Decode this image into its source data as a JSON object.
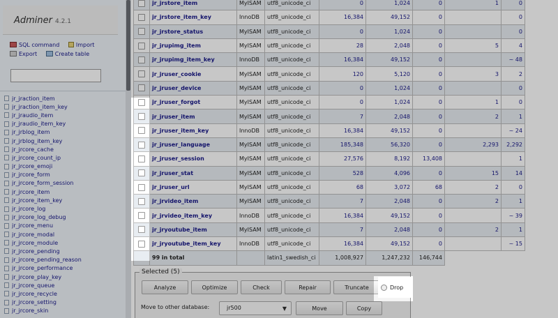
{
  "app": {
    "name": "Adminer",
    "version": "4.2.1"
  },
  "sidebar": {
    "links": [
      {
        "label": "SQL command",
        "icon": "sql-icon"
      },
      {
        "label": "Import",
        "icon": "import-icon"
      },
      {
        "label": "Export",
        "icon": "export-icon"
      },
      {
        "label": "Create table",
        "icon": "create-table-icon"
      }
    ],
    "search_value": "",
    "tables": [
      "jr_jraction_item",
      "jr_jraction_item_key",
      "jr_jraudio_item",
      "jr_jraudio_item_key",
      "jr_jrblog_item",
      "jr_jrblog_item_key",
      "jr_jrcore_cache",
      "jr_jrcore_count_ip",
      "jr_jrcore_emoji",
      "jr_jrcore_form",
      "jr_jrcore_form_session",
      "jr_jrcore_item",
      "jr_jrcore_item_key",
      "jr_jrcore_log",
      "jr_jrcore_log_debug",
      "jr_jrcore_menu",
      "jr_jrcore_modal",
      "jr_jrcore_module",
      "jr_jrcore_pending",
      "jr_jrcore_pending_reason",
      "jr_jrcore_performance",
      "jr_jrcore_play_key",
      "jr_jrcore_queue",
      "jr_jrcore_recycle",
      "jr_jrcore_setting",
      "jr_jrcore_skin"
    ]
  },
  "table": {
    "rows": [
      {
        "name": "jr_jrstore_item",
        "engine": "MyISAM",
        "collation": "utf8_unicode_ci",
        "data": "0",
        "index": "1,024",
        "free": "0",
        "auto": "1",
        "rows": "0"
      },
      {
        "name": "jr_jrstore_item_key",
        "engine": "InnoDB",
        "collation": "utf8_unicode_ci",
        "data": "16,384",
        "index": "49,152",
        "free": "0",
        "auto": "",
        "rows": "0"
      },
      {
        "name": "jr_jrstore_status",
        "engine": "MyISAM",
        "collation": "utf8_unicode_ci",
        "data": "0",
        "index": "1,024",
        "free": "0",
        "auto": "",
        "rows": "0"
      },
      {
        "name": "jr_jrupimg_item",
        "engine": "MyISAM",
        "collation": "utf8_unicode_ci",
        "data": "28",
        "index": "2,048",
        "free": "0",
        "auto": "5",
        "rows": "4"
      },
      {
        "name": "jr_jrupimg_item_key",
        "engine": "InnoDB",
        "collation": "utf8_unicode_ci",
        "data": "16,384",
        "index": "49,152",
        "free": "0",
        "auto": "",
        "rows": "~ 48"
      },
      {
        "name": "jr_jruser_cookie",
        "engine": "MyISAM",
        "collation": "utf8_unicode_ci",
        "data": "120",
        "index": "5,120",
        "free": "0",
        "auto": "3",
        "rows": "2"
      },
      {
        "name": "jr_jruser_device",
        "engine": "MyISAM",
        "collation": "utf8_unicode_ci",
        "data": "0",
        "index": "1,024",
        "free": "0",
        "auto": "",
        "rows": "0"
      },
      {
        "name": "jr_jruser_forgot",
        "engine": "MyISAM",
        "collation": "utf8_unicode_ci",
        "data": "0",
        "index": "1,024",
        "free": "0",
        "auto": "1",
        "rows": "0"
      },
      {
        "name": "jr_jruser_item",
        "engine": "MyISAM",
        "collation": "utf8_unicode_ci",
        "data": "7",
        "index": "2,048",
        "free": "0",
        "auto": "2",
        "rows": "1"
      },
      {
        "name": "jr_jruser_item_key",
        "engine": "InnoDB",
        "collation": "utf8_unicode_ci",
        "data": "16,384",
        "index": "49,152",
        "free": "0",
        "auto": "",
        "rows": "~ 24"
      },
      {
        "name": "jr_jruser_language",
        "engine": "MyISAM",
        "collation": "utf8_unicode_ci",
        "data": "185,348",
        "index": "56,320",
        "free": "0",
        "auto": "2,293",
        "rows": "2,292"
      },
      {
        "name": "jr_jruser_session",
        "engine": "MyISAM",
        "collation": "utf8_unicode_ci",
        "data": "27,576",
        "index": "8,192",
        "free": "13,408",
        "auto": "",
        "rows": "1"
      },
      {
        "name": "jr_jruser_stat",
        "engine": "MyISAM",
        "collation": "utf8_unicode_ci",
        "data": "528",
        "index": "4,096",
        "free": "0",
        "auto": "15",
        "rows": "14"
      },
      {
        "name": "jr_jruser_url",
        "engine": "MyISAM",
        "collation": "utf8_unicode_ci",
        "data": "68",
        "index": "3,072",
        "free": "68",
        "auto": "2",
        "rows": "0"
      },
      {
        "name": "jr_jrvideo_item",
        "engine": "MyISAM",
        "collation": "utf8_unicode_ci",
        "data": "7",
        "index": "2,048",
        "free": "0",
        "auto": "2",
        "rows": "1"
      },
      {
        "name": "jr_jrvideo_item_key",
        "engine": "InnoDB",
        "collation": "utf8_unicode_ci",
        "data": "16,384",
        "index": "49,152",
        "free": "0",
        "auto": "",
        "rows": "~ 39"
      },
      {
        "name": "jr_jryoutube_item",
        "engine": "MyISAM",
        "collation": "utf8_unicode_ci",
        "data": "7",
        "index": "2,048",
        "free": "0",
        "auto": "2",
        "rows": "1"
      },
      {
        "name": "jr_jryoutube_item_key",
        "engine": "InnoDB",
        "collation": "utf8_unicode_ci",
        "data": "16,384",
        "index": "49,152",
        "free": "0",
        "auto": "",
        "rows": "~ 15"
      }
    ],
    "total": {
      "label": "99 in total",
      "collation": "latin1_swedish_ci",
      "data": "1,008,927",
      "index": "1,247,232",
      "free": "146,744"
    }
  },
  "selected": {
    "legend": "Selected (5)",
    "buttons": {
      "analyze": "Analyze",
      "optimize": "Optimize",
      "check": "Check",
      "repair": "Repair",
      "truncate": "Truncate",
      "drop": "Drop",
      "move": "Move",
      "copy": "Copy"
    },
    "move_label": "Move to other database:",
    "database": "jr500"
  }
}
